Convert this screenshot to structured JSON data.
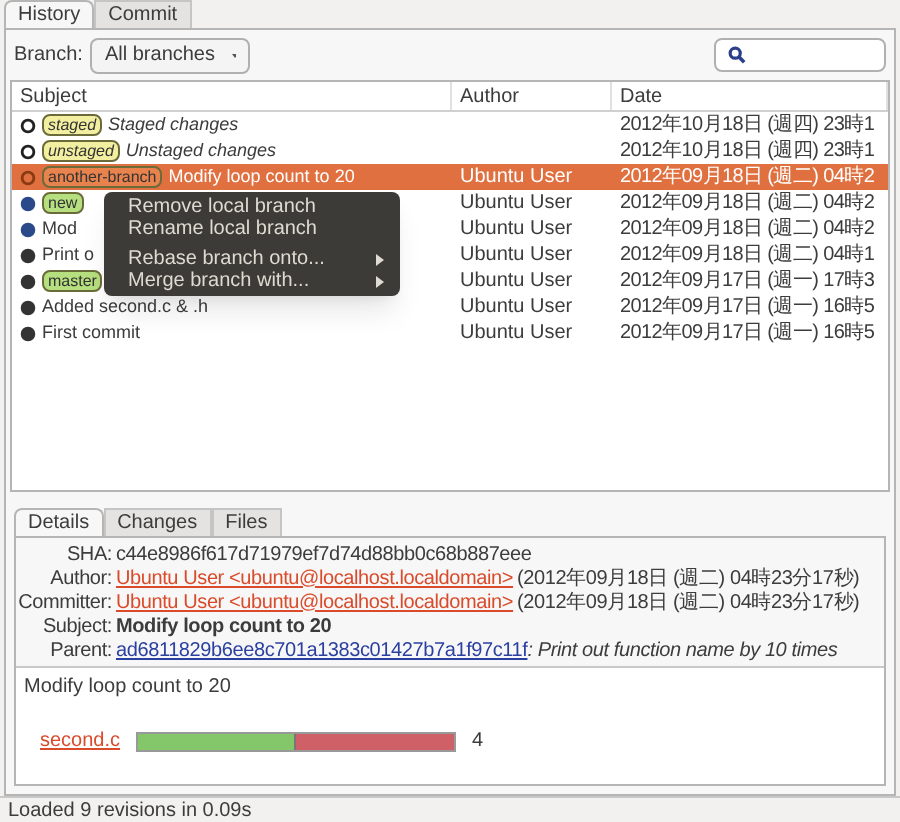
{
  "tabs": [
    {
      "label": "History",
      "selected": true
    },
    {
      "label": "Commit",
      "selected": false
    }
  ],
  "branch": {
    "label": "Branch:",
    "value": "All branches"
  },
  "table": {
    "columns": [
      "Subject",
      "Author",
      "Date"
    ],
    "rows": [
      {
        "kind": "change",
        "color": "#222222",
        "refs": [
          {
            "label": "staged",
            "color": "#f2efa0"
          }
        ],
        "subject": "Staged changes",
        "author": "",
        "date": "2012年10月18日 (週四) 23時1",
        "selected": false
      },
      {
        "kind": "change",
        "color": "#222222",
        "refs": [
          {
            "label": "unstaged",
            "color": "#f2efa0"
          }
        ],
        "subject": "Unstaged changes",
        "author": "",
        "date": "2012年10月18日 (週四) 23時1",
        "selected": false
      },
      {
        "kind": "commit-hollow",
        "color": "#8a3a12",
        "refs": [
          {
            "label": "another-branch",
            "color": "#e8834e"
          }
        ],
        "subject": "Modify loop count to 20",
        "author": "Ubuntu User",
        "date": "2012年09月18日 (週二) 04時2",
        "selected": true
      },
      {
        "kind": "commit",
        "color": "#2a4a8a",
        "refs": [
          {
            "label": "new",
            "color": "#b6df7f"
          }
        ],
        "subject": "",
        "author": "Ubuntu User",
        "date": "2012年09月18日 (週二) 04時2",
        "selected": false
      },
      {
        "kind": "commit",
        "color": "#2a4a8a",
        "refs": [],
        "subject": "Mod",
        "author": "Ubuntu User",
        "date": "2012年09月18日 (週二) 04時2",
        "selected": false
      },
      {
        "kind": "commit",
        "color": "#333333",
        "refs": [],
        "subject": "Print o",
        "author": "Ubuntu User",
        "date": "2012年09月18日 (週二) 04時1",
        "selected": false
      },
      {
        "kind": "commit",
        "color": "#333333",
        "refs": [
          {
            "label": "master",
            "color": "#b6df7f"
          }
        ],
        "subject": "",
        "author": "Ubuntu User",
        "date": "2012年09月17日 (週一) 17時3",
        "selected": false
      },
      {
        "kind": "commit",
        "color": "#333333",
        "refs": [],
        "subject": "Added second.c & .h",
        "author": "Ubuntu User",
        "date": "2012年09月17日 (週一) 16時5",
        "selected": false
      },
      {
        "kind": "commit",
        "color": "#333333",
        "refs": [],
        "subject": "First commit",
        "author": "Ubuntu User",
        "date": "2012年09月17日 (週一) 16時5",
        "selected": false
      }
    ]
  },
  "context_menu": {
    "sections": [
      [
        {
          "label": "Remove local branch",
          "submenu": false
        },
        {
          "label": "Rename local branch",
          "submenu": false
        }
      ],
      [
        {
          "label": "Rebase branch onto...",
          "submenu": true
        },
        {
          "label": "Merge branch with...",
          "submenu": true
        }
      ]
    ]
  },
  "details": {
    "tabs": [
      {
        "label": "Details",
        "selected": true
      },
      {
        "label": "Changes",
        "selected": false
      },
      {
        "label": "Files",
        "selected": false
      }
    ],
    "fields": [
      {
        "kind": "text",
        "label": "SHA:",
        "value": "c44e8986f617d71979ef7d74d88bb0c68b887eee"
      },
      {
        "kind": "person",
        "label": "Author:",
        "link": "Ubuntu User <ubuntu@localhost.localdomain>",
        "value": "(2012年09月18日 (週二) 04時23分17秒)"
      },
      {
        "kind": "person",
        "label": "Committer:",
        "link": "Ubuntu User <ubuntu@localhost.localdomain>",
        "value": "(2012年09月18日 (週二) 04時23分17秒)"
      },
      {
        "kind": "bold",
        "label": "Subject:",
        "value": "Modify loop count to 20"
      },
      {
        "kind": "parent",
        "label": "Parent:",
        "link": "ad6811829b6ee8c701a1383c01427b7a1f97c11f",
        "value": ": Print out function name by 10 times"
      }
    ],
    "message": "Modify loop count to 20",
    "files": [
      {
        "name": "second.c",
        "level": 0.5,
        "count": "4"
      }
    ]
  },
  "status_bar": "Loaded 9 revisions in 0.09s"
}
